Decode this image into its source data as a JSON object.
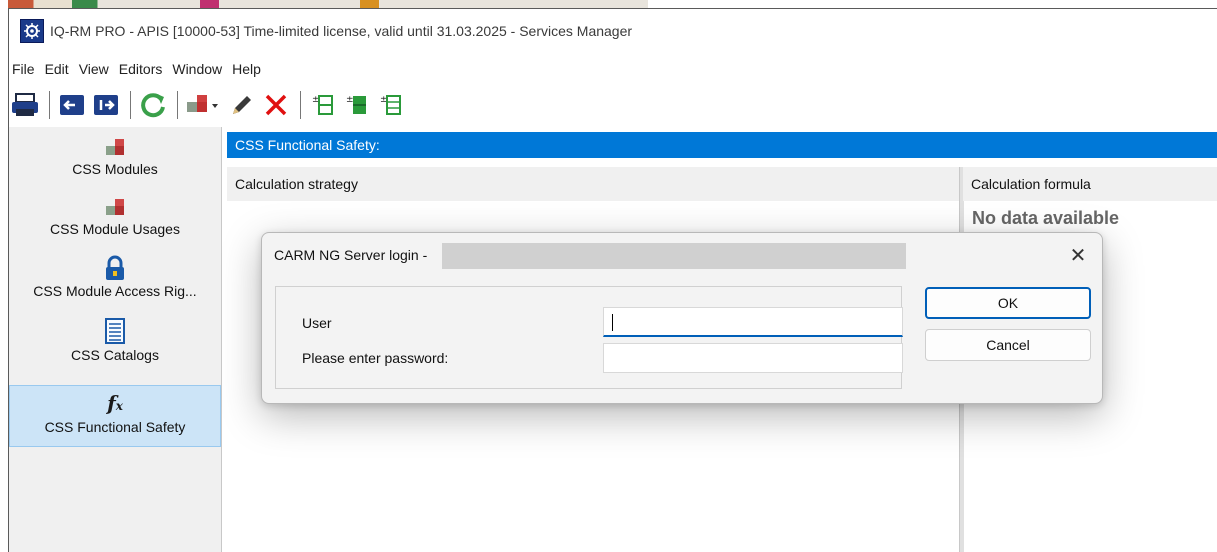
{
  "window": {
    "title": "IQ-RM PRO - APIS [10000-53] Time-limited license, valid until 31.03.2025 - Services Manager"
  },
  "menu": [
    "File",
    "Edit",
    "View",
    "Editors",
    "Window",
    "Help"
  ],
  "toolbar": {
    "icons": [
      "print-icon",
      "back-icon",
      "forward-icon",
      "refresh-icon",
      "new-module-dropdown-icon",
      "edit-pencil-icon",
      "delete-icon",
      "add-row-icon",
      "add-row-green-icon",
      "insert-row-icon"
    ]
  },
  "sidebar": {
    "items": [
      {
        "label": "CSS Modules",
        "icon": "css-modules-icon"
      },
      {
        "label": "CSS Module Usages",
        "icon": "css-module-usages-icon"
      },
      {
        "label": "CSS Module Access Rig...",
        "icon": "lock-icon"
      },
      {
        "label": "CSS Catalogs",
        "icon": "catalog-icon"
      },
      {
        "label": "CSS Functional Safety",
        "icon": "function-icon",
        "selected": true
      }
    ]
  },
  "main": {
    "header": "CSS Functional Safety:",
    "columns": [
      "Calculation strategy",
      "Calculation formula"
    ],
    "no_data": "No data available"
  },
  "dialog": {
    "title": "CARM NG Server login -",
    "user_label": "User",
    "user_value": "",
    "password_label": "Please enter password:",
    "password_value": "",
    "ok_label": "OK",
    "cancel_label": "Cancel",
    "close_glyph": "✕"
  },
  "colors": {
    "accent": "#0078d7",
    "selected_bg": "#cce4f7",
    "focus": "#005fb8"
  }
}
